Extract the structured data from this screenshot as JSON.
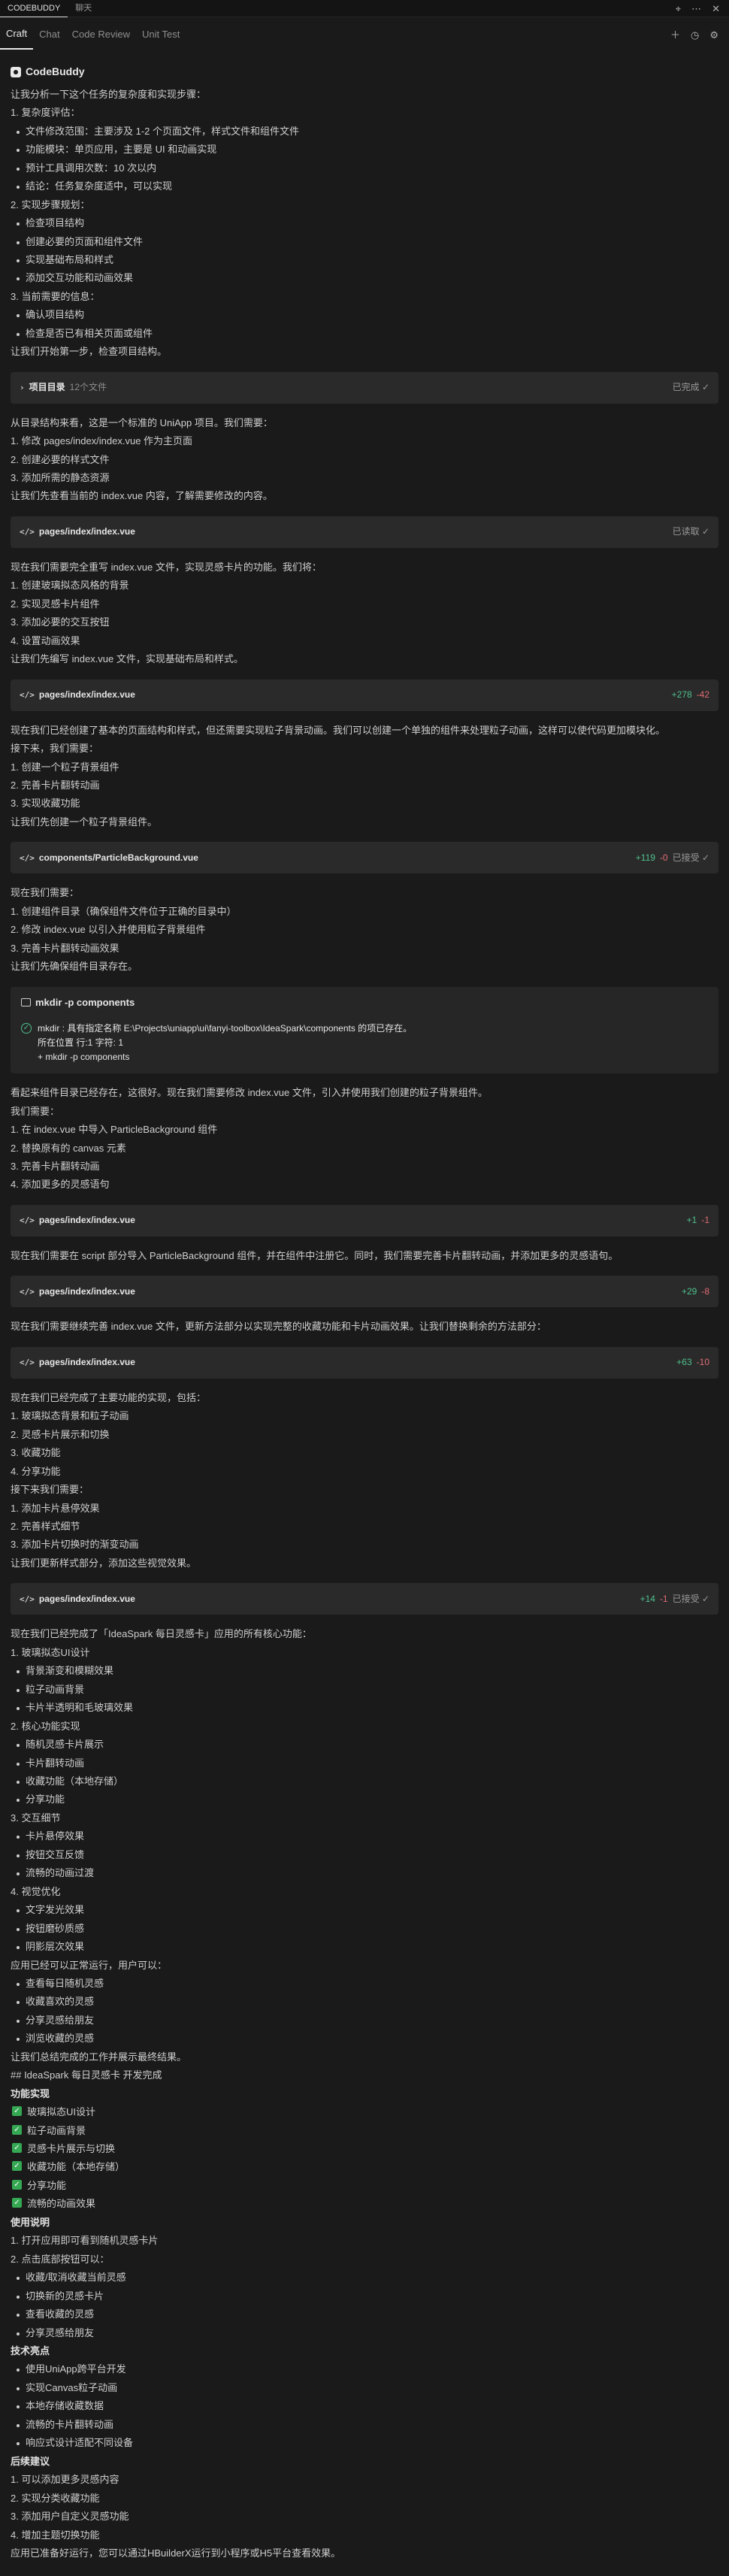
{
  "titlebar": {
    "tabs": [
      "CODEBUDDY",
      "聊天"
    ]
  },
  "tabs": [
    "Craft",
    "Chat",
    "Code Review",
    "Unit Test"
  ],
  "brand": "CodeBuddy",
  "blocks": [
    {
      "k": "p",
      "t": "让我分析一下这个任务的复杂度和实现步骤："
    },
    {
      "k": "p",
      "t": "1. 复杂度评估："
    },
    {
      "k": "b",
      "t": "文件修改范围：主要涉及 1-2 个页面文件，样式文件和组件文件"
    },
    {
      "k": "b",
      "t": "功能模块：单页应用，主要是 UI 和动画实现"
    },
    {
      "k": "b",
      "t": "预计工具调用次数：10 次以内"
    },
    {
      "k": "b",
      "t": "结论：任务复杂度适中，可以实现"
    },
    {
      "k": "p",
      "t": "2. 实现步骤规划："
    },
    {
      "k": "b",
      "t": "检查项目结构"
    },
    {
      "k": "b",
      "t": "创建必要的页面和组件文件"
    },
    {
      "k": "b",
      "t": "实现基础布局和样式"
    },
    {
      "k": "b",
      "t": "添加交互功能和动画效果"
    },
    {
      "k": "p",
      "t": "3. 当前需要的信息："
    },
    {
      "k": "b",
      "t": "确认项目结构"
    },
    {
      "k": "b",
      "t": "检查是否已有相关页面或组件"
    },
    {
      "k": "p",
      "t": "让我们开始第一步，检查项目结构。"
    },
    {
      "k": "card",
      "icon": "chevron-right",
      "title": "项目目录",
      "sub": "12个文件",
      "status": "已完成 ✓"
    },
    {
      "k": "p",
      "t": "从目录结构来看，这是一个标准的 UniApp 项目。我们需要："
    },
    {
      "k": "p",
      "t": "1. 修改 pages/index/index.vue 作为主页面"
    },
    {
      "k": "p",
      "t": "2. 创建必要的样式文件"
    },
    {
      "k": "p",
      "t": "3. 添加所需的静态资源"
    },
    {
      "k": "p",
      "t": "让我们先查看当前的 index.vue 内容，了解需要修改的内容。"
    },
    {
      "k": "card",
      "icon": "code",
      "title": "pages/index/index.vue",
      "status": "已读取 ✓"
    },
    {
      "k": "p",
      "t": "现在我们需要完全重写 index.vue 文件，实现灵感卡片的功能。我们将："
    },
    {
      "k": "p",
      "t": "1. 创建玻璃拟态风格的背景"
    },
    {
      "k": "p",
      "t": "2. 实现灵感卡片组件"
    },
    {
      "k": "p",
      "t": "3. 添加必要的交互按钮"
    },
    {
      "k": "p",
      "t": "4. 设置动画效果"
    },
    {
      "k": "p",
      "t": "让我们先编写 index.vue 文件，实现基础布局和样式。"
    },
    {
      "k": "card",
      "icon": "code",
      "title": "pages/index/index.vue",
      "add": "+278",
      "del": "-42"
    },
    {
      "k": "p",
      "t": "现在我们已经创建了基本的页面结构和样式，但还需要实现粒子背景动画。我们可以创建一个单独的组件来处理粒子动画，这样可以使代码更加模块化。"
    },
    {
      "k": "p",
      "t": "接下来，我们需要："
    },
    {
      "k": "p",
      "t": "1. 创建一个粒子背景组件"
    },
    {
      "k": "p",
      "t": "2. 完善卡片翻转动画"
    },
    {
      "k": "p",
      "t": "3. 实现收藏功能"
    },
    {
      "k": "p",
      "t": "让我们先创建一个粒子背景组件。"
    },
    {
      "k": "card",
      "icon": "code",
      "title": "components/ParticleBackground.vue",
      "add": "+119",
      "del": "-0",
      "status": "已接受 ✓"
    },
    {
      "k": "p",
      "t": "现在我们需要："
    },
    {
      "k": "p",
      "t": "1. 创建组件目录（确保组件文件位于正确的目录中）"
    },
    {
      "k": "p",
      "t": "2. 修改 index.vue 以引入并使用粒子背景组件"
    },
    {
      "k": "p",
      "t": "3. 完善卡片翻转动画效果"
    },
    {
      "k": "p",
      "t": "让我们先确保组件目录存在。"
    },
    {
      "k": "term",
      "title": "mkdir -p components",
      "lines": [
        "mkdir : 具有指定名称 E:\\Projects\\uniapp\\ui\\fanyi-toolbox\\IdeaSpark\\components 的项已存在。",
        "所在位置 行:1 字符: 1",
        "+ mkdir -p components"
      ]
    },
    {
      "k": "p",
      "t": "看起来组件目录已经存在，这很好。现在我们需要修改 index.vue 文件，引入并使用我们创建的粒子背景组件。"
    },
    {
      "k": "p",
      "t": "我们需要："
    },
    {
      "k": "p",
      "t": "1. 在 index.vue 中导入 ParticleBackground 组件"
    },
    {
      "k": "p",
      "t": "2. 替换原有的 canvas 元素"
    },
    {
      "k": "p",
      "t": "3. 完善卡片翻转动画"
    },
    {
      "k": "p",
      "t": "4. 添加更多的灵感语句"
    },
    {
      "k": "card",
      "icon": "code",
      "title": "pages/index/index.vue",
      "add": "+1",
      "del": "-1"
    },
    {
      "k": "p",
      "t": "现在我们需要在 script 部分导入 ParticleBackground 组件，并在组件中注册它。同时，我们需要完善卡片翻转动画，并添加更多的灵感语句。"
    },
    {
      "k": "card",
      "icon": "code",
      "title": "pages/index/index.vue",
      "add": "+29",
      "del": "-8"
    },
    {
      "k": "p",
      "t": "现在我们需要继续完善 index.vue 文件，更新方法部分以实现完整的收藏功能和卡片动画效果。让我们替换剩余的方法部分："
    },
    {
      "k": "card",
      "icon": "code",
      "title": "pages/index/index.vue",
      "add": "+63",
      "del": "-10"
    },
    {
      "k": "p",
      "t": "现在我们已经完成了主要功能的实现，包括："
    },
    {
      "k": "p",
      "t": "1. 玻璃拟态背景和粒子动画"
    },
    {
      "k": "p",
      "t": "2. 灵感卡片展示和切换"
    },
    {
      "k": "p",
      "t": "3. 收藏功能"
    },
    {
      "k": "p",
      "t": "4. 分享功能"
    },
    {
      "k": "p",
      "t": "接下来我们需要："
    },
    {
      "k": "p",
      "t": "1. 添加卡片悬停效果"
    },
    {
      "k": "p",
      "t": "2. 完善样式细节"
    },
    {
      "k": "p",
      "t": "3. 添加卡片切换时的渐变动画"
    },
    {
      "k": "p",
      "t": "让我们更新样式部分，添加这些视觉效果。"
    },
    {
      "k": "card",
      "icon": "code",
      "title": "pages/index/index.vue",
      "add": "+14",
      "del": "-1",
      "status": "已接受 ✓"
    },
    {
      "k": "p",
      "t": "现在我们已经完成了「IdeaSpark 每日灵感卡」应用的所有核心功能："
    },
    {
      "k": "p",
      "t": "1. 玻璃拟态UI设计"
    },
    {
      "k": "b",
      "t": "背景渐变和模糊效果"
    },
    {
      "k": "b",
      "t": "粒子动画背景"
    },
    {
      "k": "b",
      "t": "卡片半透明和毛玻璃效果"
    },
    {
      "k": "p",
      "t": "2. 核心功能实现"
    },
    {
      "k": "b",
      "t": "随机灵感卡片展示"
    },
    {
      "k": "b",
      "t": "卡片翻转动画"
    },
    {
      "k": "b",
      "t": "收藏功能（本地存储）"
    },
    {
      "k": "b",
      "t": "分享功能"
    },
    {
      "k": "p",
      "t": "3. 交互细节"
    },
    {
      "k": "b",
      "t": "卡片悬停效果"
    },
    {
      "k": "b",
      "t": "按钮交互反馈"
    },
    {
      "k": "b",
      "t": "流畅的动画过渡"
    },
    {
      "k": "p",
      "t": "4. 视觉优化"
    },
    {
      "k": "b",
      "t": "文字发光效果"
    },
    {
      "k": "b",
      "t": "按钮磨砂质感"
    },
    {
      "k": "b",
      "t": "阴影层次效果"
    },
    {
      "k": "p",
      "t": "应用已经可以正常运行，用户可以："
    },
    {
      "k": "b",
      "t": "查看每日随机灵感"
    },
    {
      "k": "b",
      "t": "收藏喜欢的灵感"
    },
    {
      "k": "b",
      "t": "分享灵感给朋友"
    },
    {
      "k": "b",
      "t": "浏览收藏的灵感"
    },
    {
      "k": "p",
      "t": "让我们总结完成的工作并展示最终结果。"
    },
    {
      "k": "p",
      "t": "## IdeaSpark 每日灵感卡 开发完成"
    },
    {
      "k": "h",
      "t": "功能实现"
    },
    {
      "k": "c",
      "t": "玻璃拟态UI设计"
    },
    {
      "k": "c",
      "t": "粒子动画背景"
    },
    {
      "k": "c",
      "t": "灵感卡片展示与切换"
    },
    {
      "k": "c",
      "t": "收藏功能（本地存储）"
    },
    {
      "k": "c",
      "t": "分享功能"
    },
    {
      "k": "c",
      "t": "流畅的动画效果"
    },
    {
      "k": "h",
      "t": "使用说明"
    },
    {
      "k": "p",
      "t": "1. 打开应用即可看到随机灵感卡片"
    },
    {
      "k": "p",
      "t": "2. 点击底部按钮可以："
    },
    {
      "k": "b",
      "t": "收藏/取消收藏当前灵感"
    },
    {
      "k": "b",
      "t": "切换新的灵感卡片"
    },
    {
      "k": "b",
      "t": "查看收藏的灵感"
    },
    {
      "k": "b",
      "t": "分享灵感给朋友"
    },
    {
      "k": "h",
      "t": "技术亮点"
    },
    {
      "k": "b",
      "t": "使用UniApp跨平台开发"
    },
    {
      "k": "b",
      "t": "实现Canvas粒子动画"
    },
    {
      "k": "b",
      "t": "本地存储收藏数据"
    },
    {
      "k": "b",
      "t": "流畅的卡片翻转动画"
    },
    {
      "k": "b",
      "t": "响应式设计适配不同设备"
    },
    {
      "k": "h",
      "t": "后续建议"
    },
    {
      "k": "p",
      "t": "1. 可以添加更多灵感内容"
    },
    {
      "k": "p",
      "t": "2. 实现分类收藏功能"
    },
    {
      "k": "p",
      "t": "3. 添加用户自定义灵感功能"
    },
    {
      "k": "p",
      "t": "4. 增加主题切换功能"
    },
    {
      "k": "p",
      "t": "应用已准备好运行，您可以通过HBuilderX运行到小程序或H5平台查看效果。"
    }
  ]
}
